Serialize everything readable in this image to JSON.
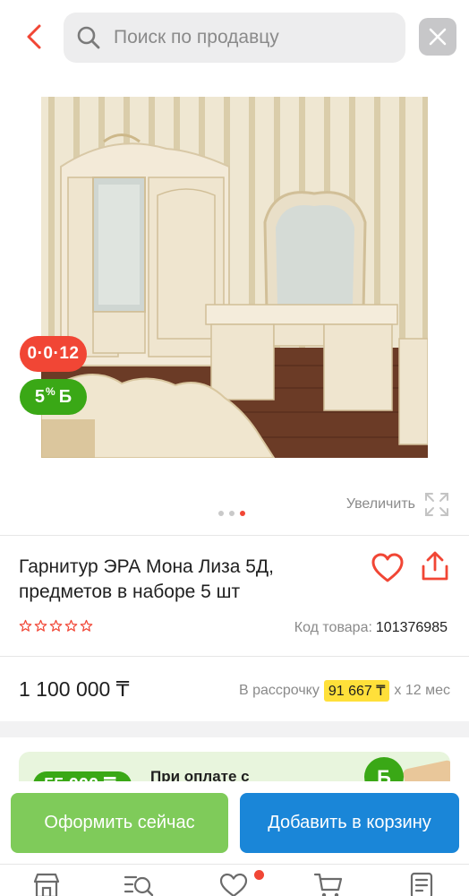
{
  "header": {
    "search_placeholder": "Поиск по продавцу",
    "back_icon": "chevron-left-icon",
    "close_icon": "close-icon"
  },
  "gallery": {
    "timer_badge": "0·0·12",
    "bonus_badge": {
      "percent": "5",
      "percent_sign": "%",
      "currency": "Б"
    },
    "zoom_label": "Увеличить",
    "dots": [
      {
        "active": false
      },
      {
        "active": false
      },
      {
        "active": true
      }
    ]
  },
  "product": {
    "title": "Гарнитур ЭРА Мона Лиза 5Д, предметов в наборе 5 шт",
    "rating": 0,
    "rating_max": 5,
    "sku_label": "Код товара:",
    "sku_value": "101376985"
  },
  "price": {
    "value": "1 100 000 ₸",
    "installment_prefix": "В рассрочку",
    "installment_amount": "91 667 ₸",
    "installment_suffix": "х 12 мес"
  },
  "promo": {
    "pill": "55 000 ₸",
    "text": "При оплате с"
  },
  "actions": {
    "checkout_label": "Оформить сейчас",
    "cart_label": "Добавить в корзину"
  },
  "bottom_nav": {
    "items": [
      "store-icon",
      "catalog-search-icon",
      "heart-icon",
      "cart-icon",
      "orders-icon"
    ]
  },
  "colors": {
    "accent_red": "#f14635",
    "green": "#3aa816",
    "checkout_green": "#7fcb5a",
    "cart_blue": "#1a86d8",
    "installment_yellow": "#ffe03a"
  }
}
